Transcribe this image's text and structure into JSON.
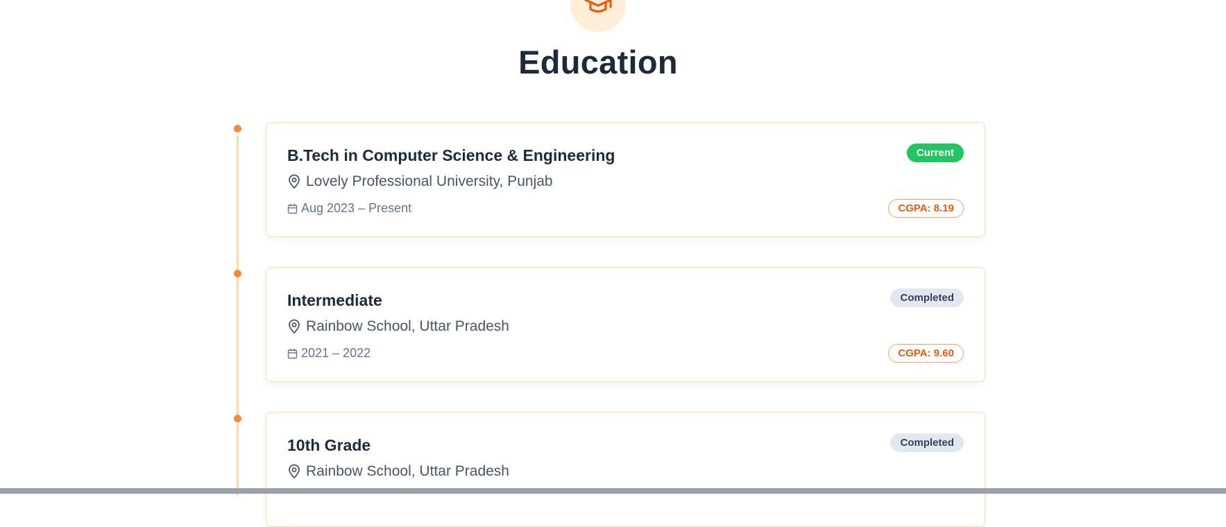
{
  "section": {
    "title": "Education",
    "icon": "graduation-cap-icon"
  },
  "colors": {
    "accent": "#f28c38",
    "accent_text": "#ea580c",
    "current_badge": "#22c55e",
    "completed_badge": "#e2e8f0",
    "timeline_line": "#fcd9a4"
  },
  "education": [
    {
      "degree": "B.Tech in Computer Science & Engineering",
      "institution": "Lovely Professional University, Punjab",
      "period": "Aug 2023 – Present",
      "status": "Current",
      "cgpa": "CGPA: 8.19"
    },
    {
      "degree": "Intermediate",
      "institution": "Rainbow School, Uttar Pradesh",
      "period": "2021 – 2022",
      "status": "Completed",
      "cgpa": "CGPA: 9.60"
    },
    {
      "degree": "10th Grade",
      "institution": "Rainbow School, Uttar Pradesh",
      "period": "",
      "status": "Completed",
      "cgpa": ""
    }
  ]
}
